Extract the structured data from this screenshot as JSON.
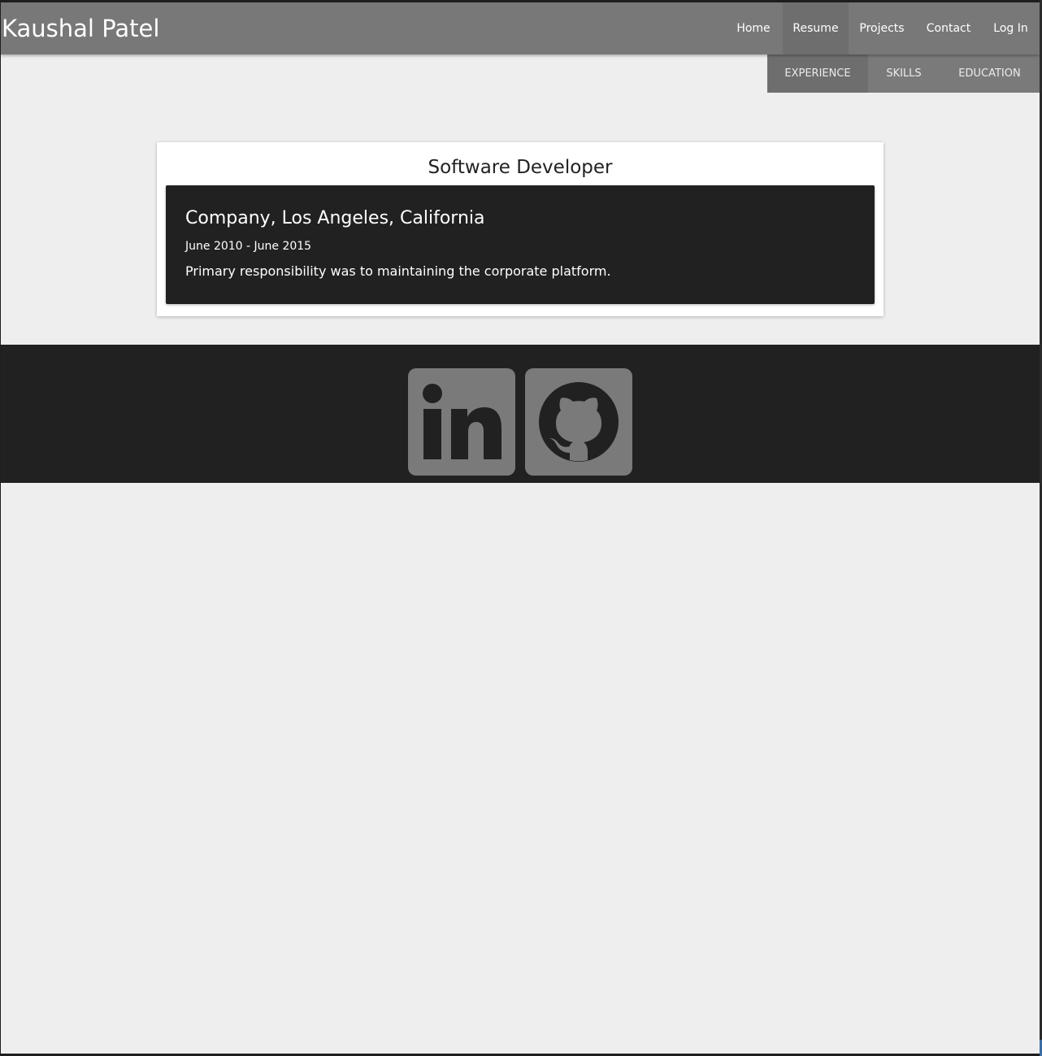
{
  "header": {
    "brand": "Kaushal Patel",
    "nav": [
      {
        "label": "Home"
      },
      {
        "label": "Resume",
        "active": true
      },
      {
        "label": "Projects"
      },
      {
        "label": "Contact"
      },
      {
        "label": "Log In"
      }
    ]
  },
  "subnav": {
    "items": [
      {
        "label": "EXPERIENCE",
        "active": true
      },
      {
        "label": "SKILLS"
      },
      {
        "label": "EDUCATION"
      }
    ]
  },
  "main": {
    "card": {
      "title": "Software Developer",
      "entry": {
        "company": "Company, Los Angeles, California",
        "dates": "June 2010 - June 2015",
        "description": "Primary responsibility was to maintaining the corporate platform."
      }
    }
  },
  "footer": {
    "social": [
      {
        "icon": "linkedin-icon"
      },
      {
        "icon": "github-icon"
      }
    ]
  },
  "colors": {
    "header_bg": "#787878",
    "active_tab_bg": "#6e6e6e",
    "page_bg": "#eeeeee",
    "dark_bg": "#212121",
    "icon_gray": "#7a7a7a"
  }
}
